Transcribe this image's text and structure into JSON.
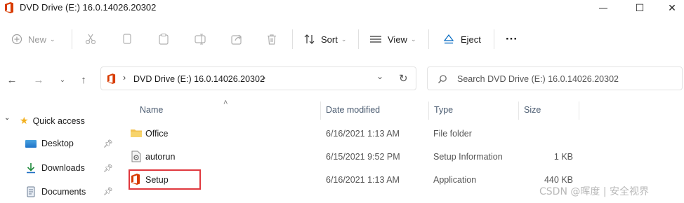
{
  "window": {
    "title": "DVD Drive (E:) 16.0.14026.20302",
    "minimize_glyph": "—",
    "maximize_glyph": "☐",
    "close_glyph": "✕"
  },
  "toolbar": {
    "new_label": "New",
    "sort_label": "Sort",
    "view_label": "View",
    "eject_label": "Eject",
    "more_label": "···"
  },
  "address": {
    "path": "DVD Drive (E:) 16.0.14026.20302",
    "separator": "›"
  },
  "search": {
    "placeholder": "Search DVD Drive (E:) 16.0.14026.20302"
  },
  "columns": {
    "name": "Name",
    "date": "Date modified",
    "type": "Type",
    "size": "Size"
  },
  "sidebar": {
    "items": [
      {
        "label": "Quick access",
        "icon": "star-icon"
      },
      {
        "label": "Desktop",
        "icon": "desktop-icon"
      },
      {
        "label": "Downloads",
        "icon": "download-icon"
      },
      {
        "label": "Documents",
        "icon": "documents-icon"
      }
    ]
  },
  "files": [
    {
      "name": "Office",
      "date": "6/16/2021 1:13 AM",
      "type": "File folder",
      "size": "",
      "icon": "folder-icon"
    },
    {
      "name": "autorun",
      "date": "6/15/2021 9:52 PM",
      "type": "Setup Information",
      "size": "1 KB",
      "icon": "setup-info-icon"
    },
    {
      "name": "Setup",
      "date": "6/16/2021 1:13 AM",
      "type": "Application",
      "size": "440 KB",
      "icon": "office-app-icon"
    }
  ],
  "watermark": "CSDN @晖度 | 安全视界",
  "colors": {
    "accent": "#0067c0",
    "office_red": "#d83b01",
    "highlight_border": "#e0383e",
    "folder_yellow": "#f2c14e"
  }
}
